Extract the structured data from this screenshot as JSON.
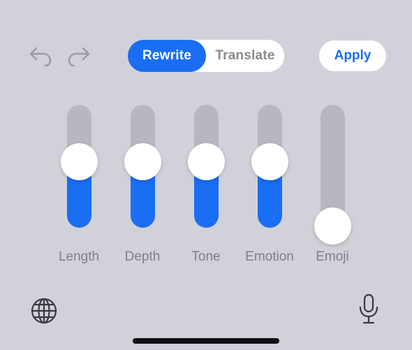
{
  "toolbar": {
    "undo_icon": "undo-arrow-icon",
    "redo_icon": "redo-arrow-icon",
    "segments": [
      {
        "label": "Rewrite",
        "selected": true
      },
      {
        "label": "Translate",
        "selected": false
      }
    ],
    "apply_label": "Apply"
  },
  "sliders": [
    {
      "label": "Length",
      "level": 0.55
    },
    {
      "label": "Depth",
      "level": 0.55
    },
    {
      "label": "Tone",
      "level": 0.55
    },
    {
      "label": "Emotion",
      "level": 0.55
    },
    {
      "label": "Emoji",
      "level": 0.0
    }
  ],
  "bottom": {
    "globe_icon": "globe-icon",
    "mic_icon": "microphone-icon"
  },
  "colors": {
    "accent": "#1a6ef4",
    "background": "#d1d2d9",
    "track": "#b7b8bf",
    "label": "#808088"
  }
}
